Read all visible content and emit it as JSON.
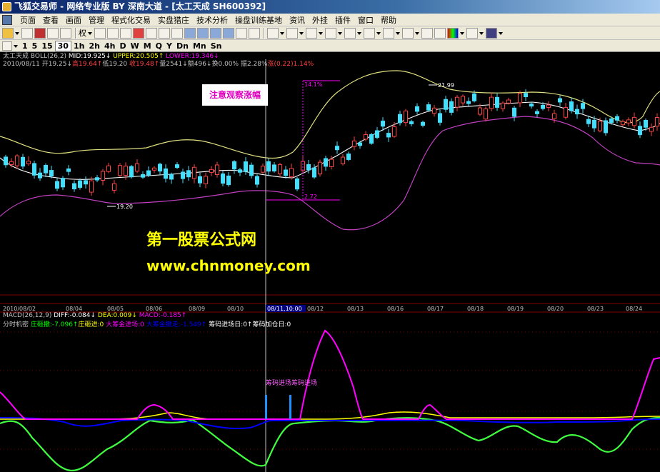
{
  "window": {
    "title": "飞狐交易师 - 网络专业版 BY 深南大道 - [太工天成 SH600392]"
  },
  "menu": [
    "页面",
    "查看",
    "画面",
    "管理",
    "程式化交易",
    "实盘猎庄",
    "技术分析",
    "操盘训练基地",
    "资讯",
    "外挂",
    "插件",
    "窗口",
    "帮助"
  ],
  "toolbar": {
    "quan_label": "权"
  },
  "periods": {
    "items": [
      "1",
      "5",
      "15",
      "30",
      "1h",
      "2h",
      "4h",
      "D",
      "W",
      "M",
      "Q",
      "Y",
      "Dn",
      "Mn",
      "Sn"
    ],
    "active": "30"
  },
  "main_panel": {
    "header_line1": [
      {
        "text": "太工天成 BOLL(26,2) ",
        "color": "#c0c0c0"
      },
      {
        "text": "MID:19.925↓",
        "color": "#ffffff"
      },
      {
        "text": " UPPER:20.505↑",
        "color": "#ffff00"
      },
      {
        "text": " LOWER:19.346↓",
        "color": "#ff00ff"
      }
    ],
    "header_line2": [
      {
        "text": "2010/08/11 ",
        "color": "#c0c0c0"
      },
      {
        "text": "开19.25↓",
        "color": "#c0c0c0"
      },
      {
        "text": "高19.64↑",
        "color": "#ff4040"
      },
      {
        "text": "低19.20",
        "color": "#c0c0c0"
      },
      {
        "text": " 收19.48↑",
        "color": "#ff4040"
      },
      {
        "text": "量2541↓",
        "color": "#c0c0c0"
      },
      {
        "text": "额496↓",
        "color": "#c0c0c0"
      },
      {
        "text": "换0.00%",
        "color": "#c0c0c0"
      },
      {
        "text": " 振2.28%",
        "color": "#c0c0c0"
      },
      {
        "text": "涨(0.22)1.14%",
        "color": "#ff4040"
      }
    ],
    "annotation": "注意观察涨幅",
    "labels": {
      "high_price": "21.99",
      "low_price": "19.20",
      "range_top": "14.1%",
      "range_bottom": "2.72"
    }
  },
  "watermark": {
    "line1": "第一股票公式网",
    "line2": "www.chnmoney.com"
  },
  "time_axis": {
    "labels": [
      "2010/08/02",
      "08/04",
      "08/05",
      "08/06",
      "08/09",
      "08/10",
      "08/11,10:00",
      "08/12",
      "08/13",
      "08/16",
      "08/17",
      "08/18",
      "08/19",
      "08/20",
      "08/23",
      "08/24"
    ]
  },
  "macd_header": [
    {
      "text": "MACD(26,12,9) ",
      "color": "#c0c0c0"
    },
    {
      "text": "DIFF:-0.084↓",
      "color": "#ffffff"
    },
    {
      "text": " DEA:0.009↓",
      "color": "#ffff00"
    },
    {
      "text": " MACD:-0.185↑",
      "color": "#ff00ff"
    }
  ],
  "indicator_panel": {
    "header": [
      {
        "text": "分时机密 ",
        "color": "#c0c0c0"
      },
      {
        "text": "庄砸撤:-7.096↑",
        "color": "#00ff00"
      },
      {
        "text": "庄砸进:0 ",
        "color": "#ffff00"
      },
      {
        "text": "大筹金进场:0 ",
        "color": "#ff00ff"
      },
      {
        "text": "大筹金撤走:-1.549↑",
        "color": "#0000ff"
      },
      {
        "text": " 筹码进场日:0↑",
        "color": "#ffffff"
      },
      {
        "text": "筹码加仓日:0",
        "color": "#ffffff"
      }
    ],
    "label": "筹码进场筹码进场"
  }
}
